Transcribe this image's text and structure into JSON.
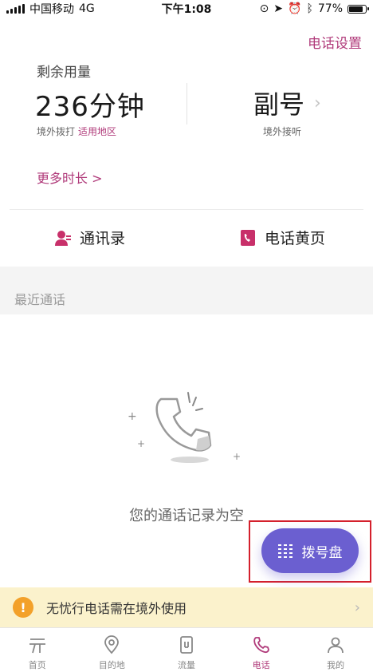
{
  "status": {
    "carrier": "中国移动",
    "network": "4G",
    "time": "下午1:08",
    "battery": "77%",
    "battery_level": 0.77
  },
  "header": {
    "settings_link": "电话设置"
  },
  "usage": {
    "title": "剩余用量",
    "amount": "236分钟",
    "sub_label": "境外拨打",
    "sub_link": "适用地区",
    "secondary_title": "副号",
    "secondary_sub": "境外接听",
    "more_time": "更多时长 >"
  },
  "shortcuts": {
    "contacts": "通讯录",
    "yellow_pages": "电话黄页"
  },
  "recent": {
    "title": "最近通话",
    "empty_text": "您的通话记录为空"
  },
  "fab": {
    "label": "拨号盘"
  },
  "banner": {
    "text": "无忧行电话需在境外使用"
  },
  "tabs": [
    {
      "label": "首页"
    },
    {
      "label": "目的地"
    },
    {
      "label": "流量"
    },
    {
      "label": "电话"
    },
    {
      "label": "我的"
    }
  ],
  "colors": {
    "accent": "#b03a7a",
    "fab": "#6b5fd0",
    "banner_bg": "#fbf2cc",
    "warn": "#f3a12a"
  }
}
